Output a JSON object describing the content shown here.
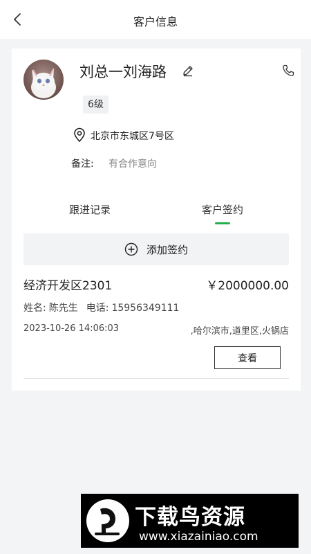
{
  "header": {
    "title": "客户信息"
  },
  "customer": {
    "name": "刘总一刘海路",
    "level": "6级",
    "address": "北京市东城区7号区",
    "remark_label": "备注:",
    "remark_value": "有合作意向"
  },
  "tabs": [
    {
      "label": "跟进记录",
      "active": false
    },
    {
      "label": "客户签约",
      "active": true
    }
  ],
  "add_button_label": "添加签约",
  "record": {
    "name": "经济开发区2301",
    "amount": "￥2000000.00",
    "contact_name_label": "姓名:",
    "contact_name": "陈先生",
    "phone_label": "电话:",
    "phone": "15956349111",
    "time": "2023-10-26 14:06:03",
    "place": ",哈尔滨市,道里区,火锅店",
    "view_label": "查看"
  },
  "watermark": {
    "title": "下载鸟资源",
    "url": "www.xiazainiao.com"
  },
  "colors": {
    "accent": "#22b04c",
    "background": "#f3f4f6"
  }
}
